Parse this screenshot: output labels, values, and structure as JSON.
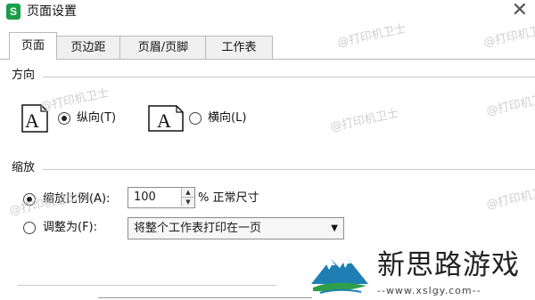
{
  "window": {
    "app_icon_letter": "S",
    "title": "页面设置"
  },
  "tabs": [
    {
      "label": "页面",
      "active": true
    },
    {
      "label": "页边距",
      "active": false
    },
    {
      "label": "页眉/页脚",
      "active": false
    },
    {
      "label": "工作表",
      "active": false
    }
  ],
  "orientation": {
    "section_label": "方向",
    "portrait": {
      "icon_letter": "A",
      "label": "纵向(T)",
      "selected": true
    },
    "landscape": {
      "icon_letter": "A",
      "label": "横向(L)",
      "selected": false
    }
  },
  "scaling": {
    "section_label": "缩放",
    "scale_option": {
      "label": "缩放比例(A):",
      "selected": true,
      "value": "100",
      "suffix": "% 正常尺寸"
    },
    "fit_option": {
      "label": "调整为(F):",
      "selected": false,
      "select_value": "将整个工作表打印在一页"
    }
  },
  "watermark": {
    "text": "@打印机卫士"
  },
  "brand": {
    "name": "新思路游戏",
    "url": "--www.xslgy.com--"
  },
  "colors": {
    "app_icon": "#1b9e4b",
    "logo_mountain": "#1f7fb5",
    "logo_leaf": "#2e9e4a"
  }
}
